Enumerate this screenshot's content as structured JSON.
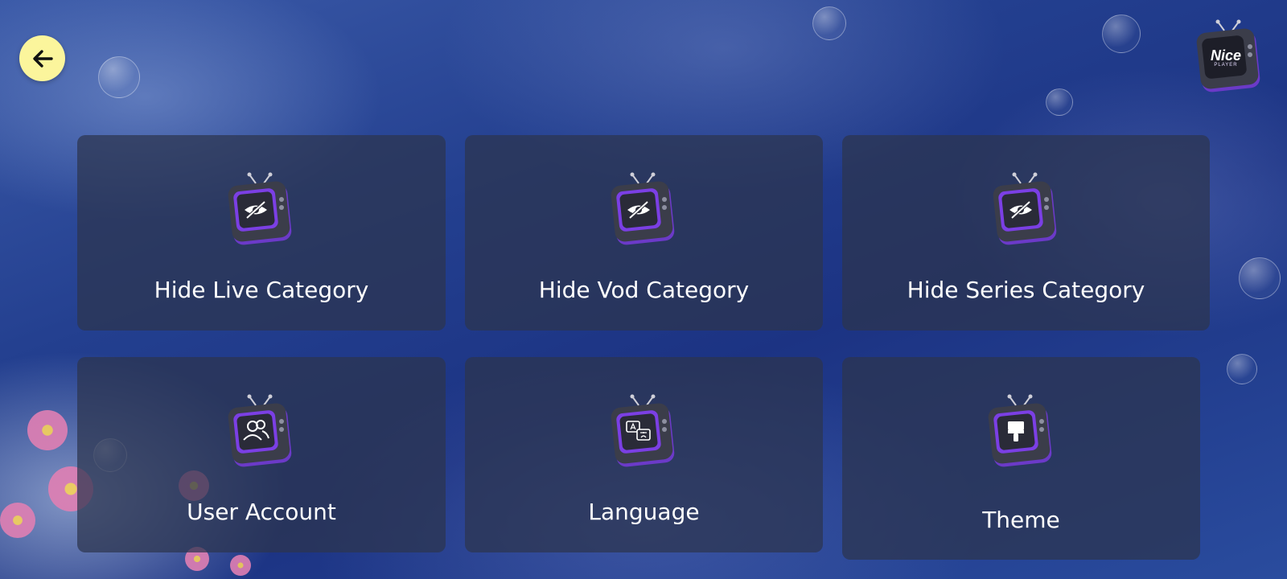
{
  "header": {
    "back_icon": "arrow-left-icon",
    "logo": {
      "icon": "tv-logo-icon",
      "text": "Nice",
      "subtext": "PLAYER"
    }
  },
  "tiles": [
    {
      "label": "Hide Live Category",
      "icon": "eye-off-icon"
    },
    {
      "label": "Hide Vod Category",
      "icon": "eye-off-icon"
    },
    {
      "label": "Hide Series Category",
      "icon": "eye-off-icon"
    },
    {
      "label": "User Account",
      "icon": "users-icon"
    },
    {
      "label": "Language",
      "icon": "translate-icon"
    },
    {
      "label": "Theme",
      "icon": "paint-brush-icon"
    }
  ],
  "colors": {
    "back_button": "#fbf59c",
    "tile_background": "#2c344e",
    "icon_accent": "#7b3fe4",
    "sky": "#233f8f"
  }
}
